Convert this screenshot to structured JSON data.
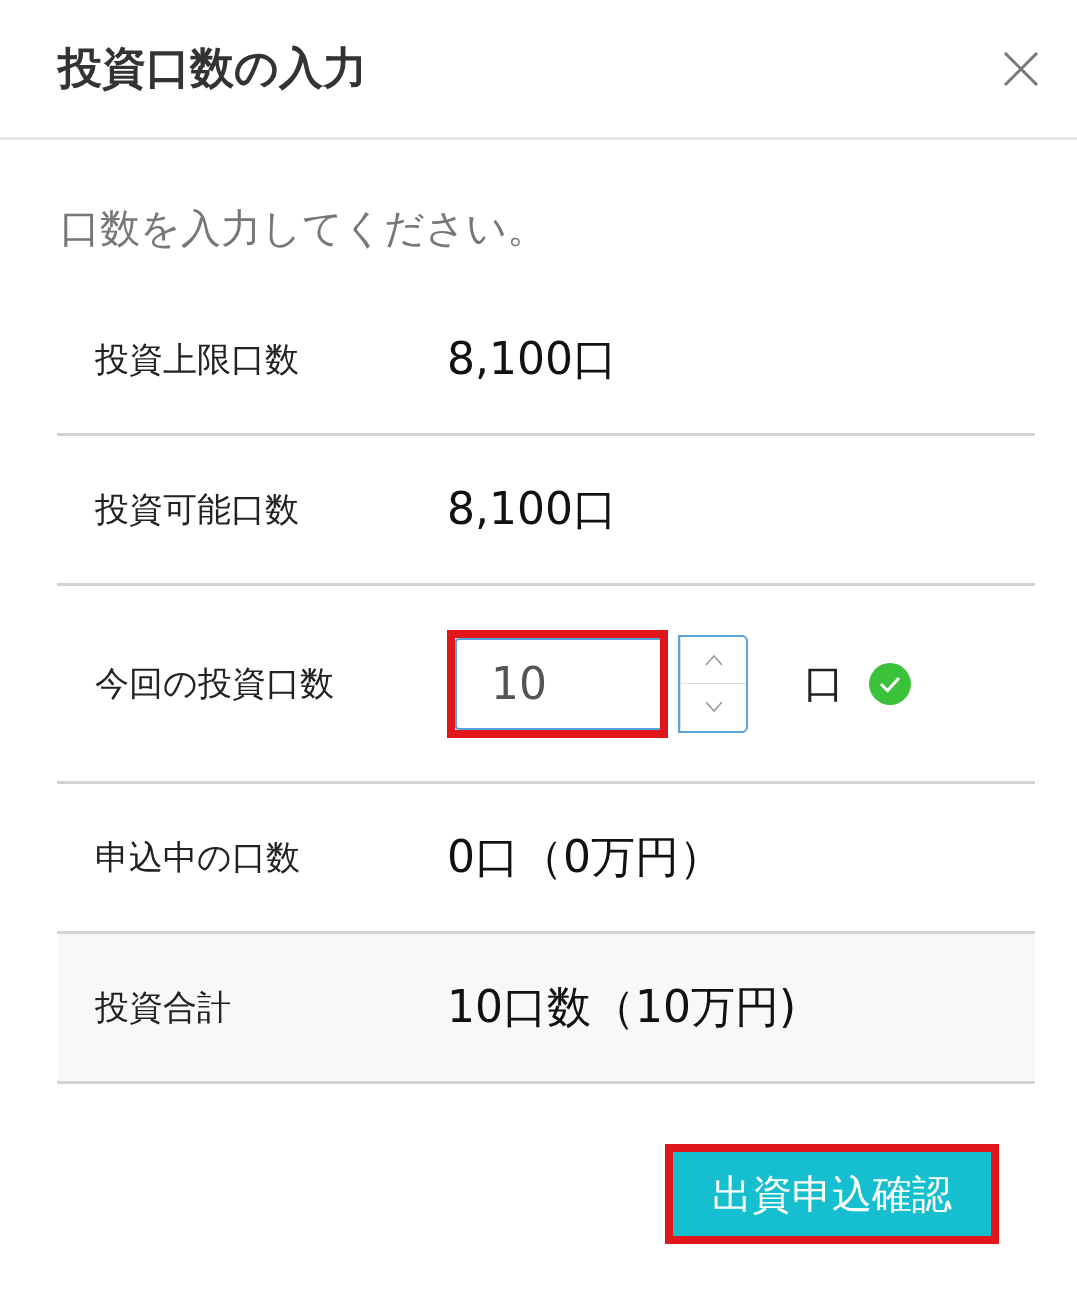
{
  "dialog": {
    "title": "投資口数の入力"
  },
  "instruction": "口数を入力してください。",
  "rows": [
    {
      "kind": "text",
      "label": "投資上限口数",
      "value": "8,100口"
    },
    {
      "kind": "text",
      "label": "投資可能口数",
      "value": "8,100口"
    },
    {
      "kind": "input",
      "label": "今回の投資口数",
      "value": "10",
      "unit": "口",
      "valid": true,
      "highlighted": true
    },
    {
      "kind": "text",
      "label": "申込中の口数",
      "value": "0口（0万円）"
    },
    {
      "kind": "total",
      "label": "投資合計",
      "value": "10口数（10万円)"
    }
  ],
  "submit": {
    "label": "出資申込確認",
    "highlighted": true
  }
}
